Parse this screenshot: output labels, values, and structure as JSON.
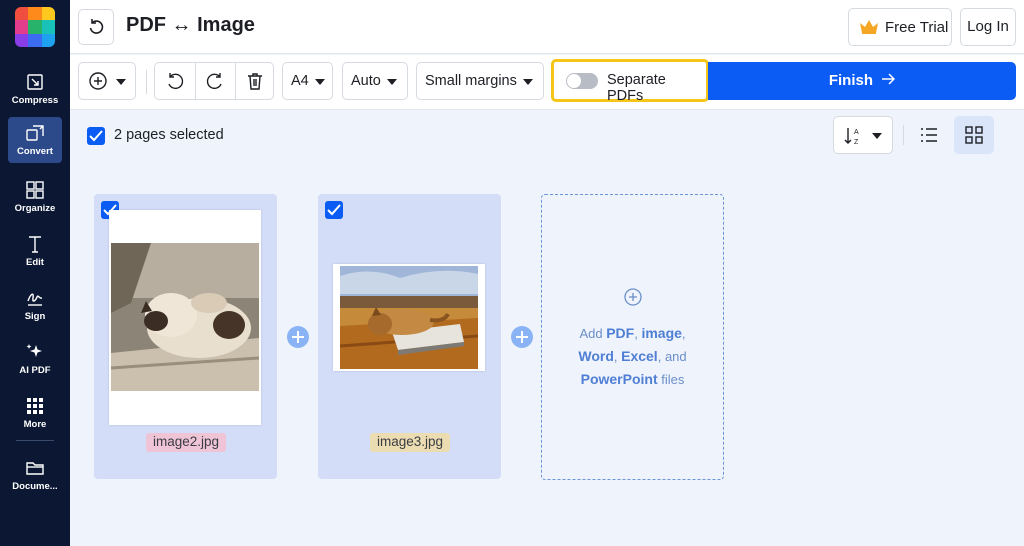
{
  "header": {
    "title": "PDF ↔ Image",
    "free_trial_label": "Free Trial",
    "login_label": "Log In"
  },
  "sidebar": {
    "items": [
      {
        "label": "Compress",
        "icon": "compress-icon",
        "active": false
      },
      {
        "label": "Convert",
        "icon": "convert-icon",
        "active": true
      },
      {
        "label": "Organize",
        "icon": "organize-icon",
        "active": false
      },
      {
        "label": "Edit",
        "icon": "edit-icon",
        "active": false
      },
      {
        "label": "Sign",
        "icon": "sign-icon",
        "active": false
      },
      {
        "label": "AI PDF",
        "icon": "ai-sparkle-icon",
        "active": false
      },
      {
        "label": "More",
        "icon": "more-grid-icon",
        "active": false
      },
      {
        "label": "Docume...",
        "icon": "folder-icon",
        "active": false
      }
    ]
  },
  "toolbar": {
    "page_size": "A4",
    "orientation": "Auto",
    "margins": "Small margins",
    "separate_pdfs_label": "Separate PDFs",
    "separate_pdfs_on": false,
    "finish_label": "Finish"
  },
  "selection": {
    "text": "2 pages selected",
    "checked": true
  },
  "files": [
    {
      "name": "image2.jpg",
      "selected": true,
      "tag_color": "#efc4d6"
    },
    {
      "name": "image3.jpg",
      "selected": true,
      "tag_color": "#ecdcb2"
    }
  ],
  "add_zone": {
    "prefix": "Add",
    "pdf": "PDF",
    "image": "image",
    "word": "Word",
    "excel": "Excel",
    "and": "and",
    "powerpoint": "PowerPoint",
    "suffix": "files"
  },
  "colors": {
    "accent": "#0a5cf5",
    "sidebar_bg": "#0c1833",
    "highlight": "#f5c518",
    "card_bg": "#d3ddf8"
  }
}
